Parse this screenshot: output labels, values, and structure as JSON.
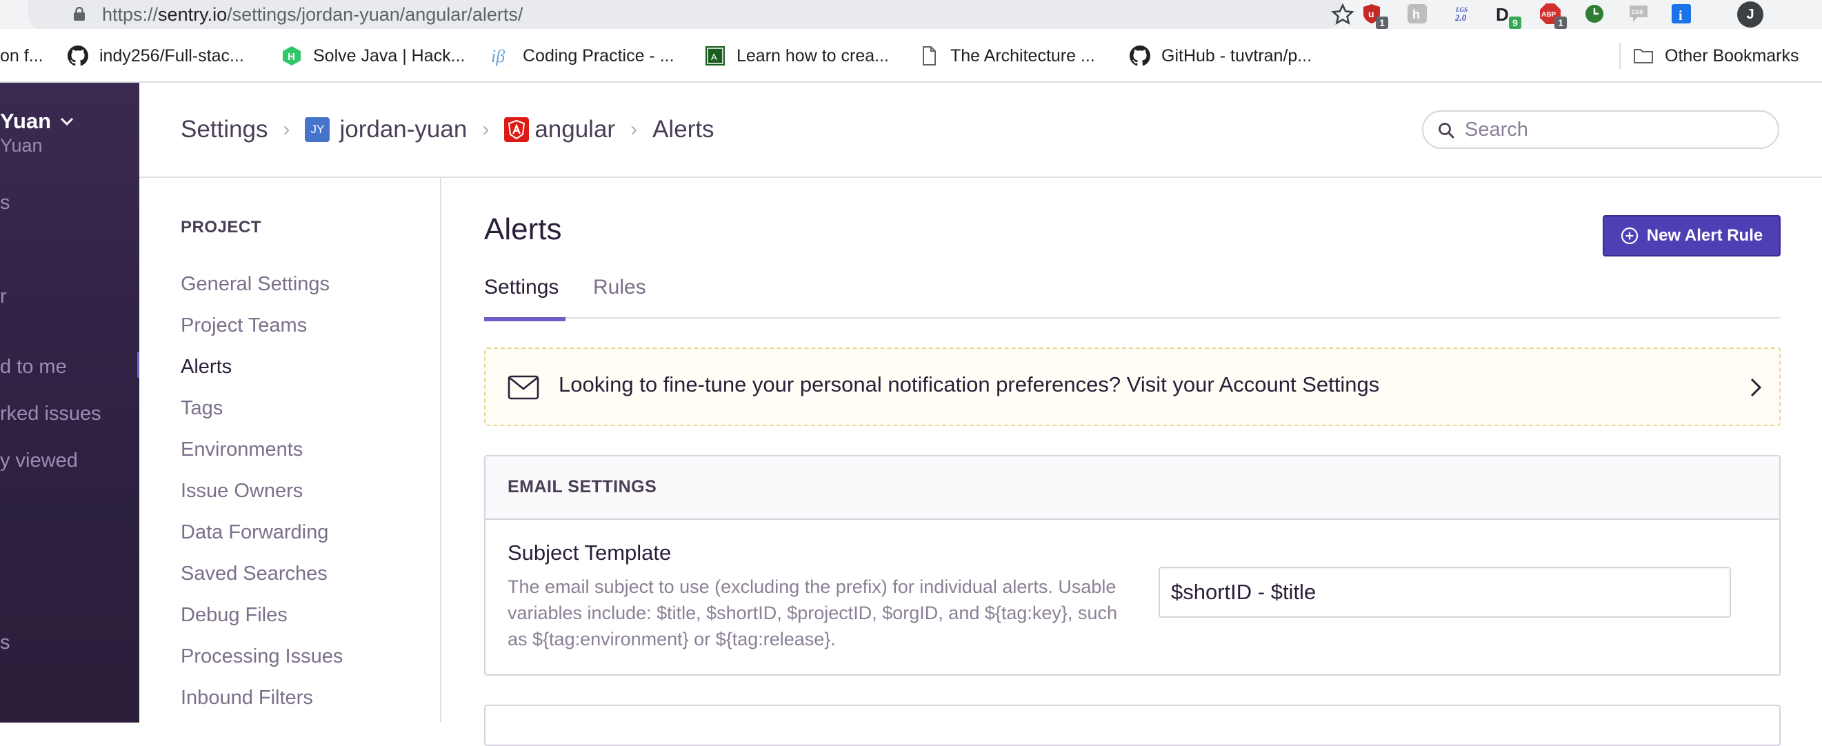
{
  "browser": {
    "url_prefix": "https://",
    "url_host": "sentry.io",
    "url_path": "/settings/jordan-yuan/angular/alerts/",
    "extensions": [
      {
        "name": "ublock-icon",
        "badge": "1",
        "color": "#c62828"
      },
      {
        "name": "hacker-icon",
        "badge": "",
        "color": "#bdbdbd"
      },
      {
        "name": "jsonview-icon",
        "badge": "",
        "color": "#ffffff"
      },
      {
        "name": "dark-reader-icon",
        "badge": "9",
        "color": "#202124"
      },
      {
        "name": "adblock-icon",
        "badge": "1",
        "color": "#d32f2f"
      },
      {
        "name": "clock-icon",
        "badge": "",
        "color": "#34a853"
      },
      {
        "name": "css-icon",
        "badge": "",
        "color": "#bdbdbd"
      },
      {
        "name": "info-icon",
        "badge": "",
        "color": "#1a73e8"
      }
    ],
    "profile_initial": "J"
  },
  "bookmarks": [
    {
      "label": "on f...",
      "icon": "none"
    },
    {
      "label": "indy256/Full-stac...",
      "icon": "github-icon"
    },
    {
      "label": "Solve Java | Hack...",
      "icon": "hackerrank-icon"
    },
    {
      "label": "Coding Practice - ...",
      "icon": "interviewbit-icon"
    },
    {
      "label": "Learn how to crea...",
      "icon": "angular-green-icon"
    },
    {
      "label": "The Architecture ...",
      "icon": "page-icon"
    },
    {
      "label": "GitHub - tuvtran/p...",
      "icon": "github-icon"
    },
    {
      "label": "Other Bookmarks",
      "icon": "folder-icon"
    }
  ],
  "org_sidebar": {
    "org_name": "Yuan",
    "org_sub": "Yuan",
    "items": [
      "s",
      "r",
      "d to me",
      "rked issues",
      "y viewed",
      "s"
    ]
  },
  "header": {
    "breadcrumb": {
      "root": "Settings",
      "org_initials": "JY",
      "org": "jordan-yuan",
      "project": "angular",
      "page": "Alerts"
    },
    "search_placeholder": "Search"
  },
  "project_nav": {
    "heading": "PROJECT",
    "items": [
      "General Settings",
      "Project Teams",
      "Alerts",
      "Tags",
      "Environments",
      "Issue Owners",
      "Data Forwarding",
      "Saved Searches",
      "Debug Files",
      "Processing Issues",
      "Inbound Filters"
    ],
    "active_index": 2
  },
  "main": {
    "title": "Alerts",
    "new_rule_label": "New Alert Rule",
    "tabs": [
      {
        "label": "Settings",
        "active": true
      },
      {
        "label": "Rules",
        "active": false
      }
    ],
    "banner_text": "Looking to fine-tune your personal notification preferences? Visit your Account Settings",
    "email_settings": {
      "title": "EMAIL SETTINGS",
      "subject_label": "Subject Template",
      "subject_help": "The email subject to use (excluding the prefix) for individual alerts. Usable variables include: $title, $shortID, $projectID, $orgID, and ${tag:key}, such as ${tag:environment} or ${tag:release}.",
      "subject_value": "$shortID - $title"
    }
  },
  "colors": {
    "accent": "#6c5fc7",
    "button": "#4e3fb4",
    "sidebar": "#2d2040"
  }
}
